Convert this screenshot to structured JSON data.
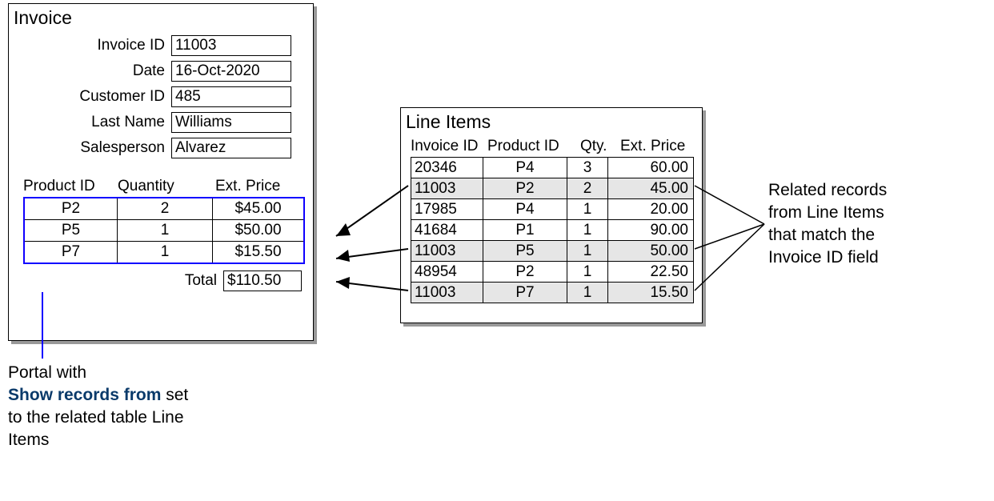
{
  "invoice": {
    "title": "Invoice",
    "labels": {
      "invoice_id": "Invoice ID",
      "date": "Date",
      "customer_id": "Customer ID",
      "last_name": "Last Name",
      "salesperson": "Salesperson"
    },
    "fields": {
      "invoice_id": "11003",
      "date": "16-Oct-2020",
      "customer_id": "485",
      "last_name": "Williams",
      "salesperson": "Alvarez"
    },
    "portal": {
      "headers": {
        "product_id": "Product ID",
        "quantity": "Quantity",
        "ext_price": "Ext. Price"
      },
      "rows": [
        {
          "product_id": "P2",
          "quantity": "2",
          "ext_price": "$45.00"
        },
        {
          "product_id": "P5",
          "quantity": "1",
          "ext_price": "$50.00"
        },
        {
          "product_id": "P7",
          "quantity": "1",
          "ext_price": "$15.50"
        }
      ],
      "total_label": "Total",
      "total_value": "$110.50"
    }
  },
  "lineitems": {
    "title": "Line Items",
    "headers": {
      "invoice_id": "Invoice ID",
      "product_id": "Product ID",
      "qty": "Qty.",
      "ext_price": "Ext. Price"
    },
    "rows": [
      {
        "invoice_id": "20346",
        "product_id": "P4",
        "qty": "3",
        "ext_price": "60.00",
        "highlight": false
      },
      {
        "invoice_id": "11003",
        "product_id": "P2",
        "qty": "2",
        "ext_price": "45.00",
        "highlight": true
      },
      {
        "invoice_id": "17985",
        "product_id": "P4",
        "qty": "1",
        "ext_price": "20.00",
        "highlight": false
      },
      {
        "invoice_id": "41684",
        "product_id": "P1",
        "qty": "1",
        "ext_price": "90.00",
        "highlight": false
      },
      {
        "invoice_id": "11003",
        "product_id": "P5",
        "qty": "1",
        "ext_price": "50.00",
        "highlight": true
      },
      {
        "invoice_id": "48954",
        "product_id": "P2",
        "qty": "1",
        "ext_price": "22.50",
        "highlight": false
      },
      {
        "invoice_id": "11003",
        "product_id": "P7",
        "qty": "1",
        "ext_price": "15.50",
        "highlight": true
      }
    ]
  },
  "annotations": {
    "left": {
      "line1": "Portal with",
      "bold": "Show records from",
      "after_bold": " set",
      "line3": "to the related table Line",
      "line4": "Items"
    },
    "right": {
      "line1": "Related records",
      "line2": "from Line Items",
      "line3": "that match the",
      "line4": "Invoice ID field"
    }
  }
}
